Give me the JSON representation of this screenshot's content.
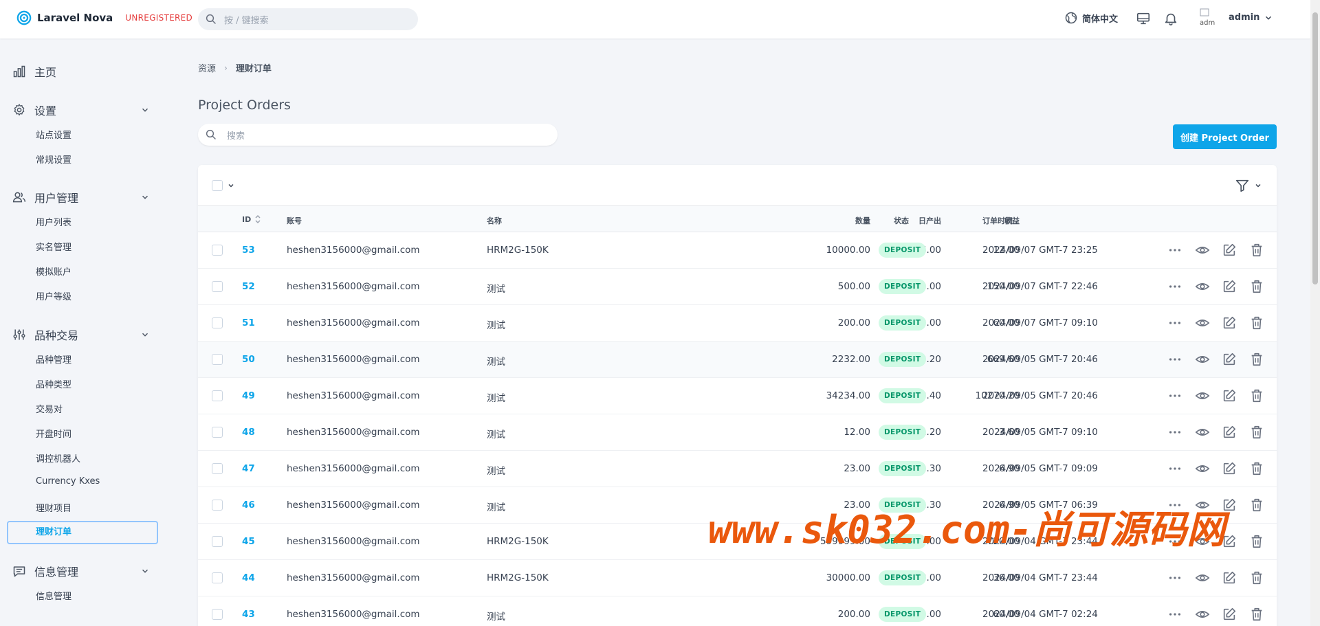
{
  "header": {
    "brand": "Laravel Nova",
    "unregistered": "UNREGISTERED",
    "search_placeholder": "按 / 键搜索",
    "language": "简体中文",
    "avatar_alt": "adm",
    "username": "admin"
  },
  "sidebar": {
    "home": "主页",
    "settings": {
      "label": "设置",
      "items": [
        "站点设置",
        "常规设置"
      ]
    },
    "users": {
      "label": "用户管理",
      "items": [
        "用户列表",
        "实名管理",
        "模拟账户",
        "用户等级"
      ]
    },
    "trading": {
      "label": "品种交易",
      "items": [
        "品种管理",
        "品种类型",
        "交易对",
        "开盘时间",
        "调控机器人",
        "Currency Kxes",
        "理财项目",
        "理财订单"
      ]
    },
    "messages": {
      "label": "信息管理",
      "items": [
        "信息管理"
      ]
    }
  },
  "breadcrumb": {
    "root": "资源",
    "current": "理财订单"
  },
  "page": {
    "title": "Project Orders",
    "search_placeholder": "搜索",
    "create_button": "创建 Project Order"
  },
  "table": {
    "columns": {
      "id": "ID",
      "account": "账号",
      "name": "名称",
      "quantity": "数量",
      "daily": "日产出",
      "income": "收益",
      "status": "状态",
      "time": "订单时间"
    },
    "rows": [
      {
        "id": "53",
        "account": "heshen3156000@gmail.com",
        "name": "HRM2G-150K",
        "quantity": "10000.00",
        "daily": "6.00",
        "income": "12.00",
        "status": "DEPOSIT",
        "time": "2024/09/07 GMT-7 23:25"
      },
      {
        "id": "52",
        "account": "heshen3156000@gmail.com",
        "name": "测试",
        "quantity": "500.00",
        "daily": "50.00",
        "income": "150.00",
        "status": "DEPOSIT",
        "time": "2024/09/07 GMT-7 22:46"
      },
      {
        "id": "51",
        "account": "heshen3156000@gmail.com",
        "name": "测试",
        "quantity": "200.00",
        "daily": "20.00",
        "income": "60.00",
        "status": "DEPOSIT",
        "time": "2024/09/07 GMT-7 09:10"
      },
      {
        "id": "50",
        "account": "heshen3156000@gmail.com",
        "name": "测试",
        "quantity": "2232.00",
        "daily": "223.20",
        "income": "669.60",
        "status": "DEPOSIT",
        "time": "2024/09/05 GMT-7 20:46"
      },
      {
        "id": "49",
        "account": "heshen3156000@gmail.com",
        "name": "测试",
        "quantity": "34234.00",
        "daily": "3423.40",
        "income": "10270.20",
        "status": "DEPOSIT",
        "time": "2024/09/05 GMT-7 20:46"
      },
      {
        "id": "48",
        "account": "heshen3156000@gmail.com",
        "name": "测试",
        "quantity": "12.00",
        "daily": "1.20",
        "income": "3.60",
        "status": "DEPOSIT",
        "time": "2024/09/05 GMT-7 09:10"
      },
      {
        "id": "47",
        "account": "heshen3156000@gmail.com",
        "name": "测试",
        "quantity": "23.00",
        "daily": "2.30",
        "income": "6.90",
        "status": "DEPOSIT",
        "time": "2024/09/05 GMT-7 09:09"
      },
      {
        "id": "46",
        "account": "heshen3156000@gmail.com",
        "name": "测试",
        "quantity": "23.00",
        "daily": "2.30",
        "income": "6.90",
        "status": "DEPOSIT",
        "time": "2024/09/05 GMT-7 06:39"
      },
      {
        "id": "45",
        "account": "heshen3156000@gmail.com",
        "name": "HRM2G-150K",
        "quantity": "599999.00",
        "daily": "360.00",
        "income": "720.00",
        "status": "DEPOSIT",
        "time": "2024/09/04 GMT-7 23:44"
      },
      {
        "id": "44",
        "account": "heshen3156000@gmail.com",
        "name": "HRM2G-150K",
        "quantity": "30000.00",
        "daily": "18.00",
        "income": "36.00",
        "status": "DEPOSIT",
        "time": "2024/09/04 GMT-7 23:44"
      },
      {
        "id": "43",
        "account": "heshen3156000@gmail.com",
        "name": "测试",
        "quantity": "200.00",
        "daily": "20.00",
        "income": "60.00",
        "status": "DEPOSIT",
        "time": "2024/09/04 GMT-7 02:24"
      }
    ]
  },
  "watermark": "www.sk032.com-尚可源码网",
  "colors": {
    "accent": "#0ea5e9",
    "badge_bg": "#d1fae5",
    "badge_text": "#059669",
    "watermark": "#ea580c",
    "unregistered": "#e53e3e"
  }
}
